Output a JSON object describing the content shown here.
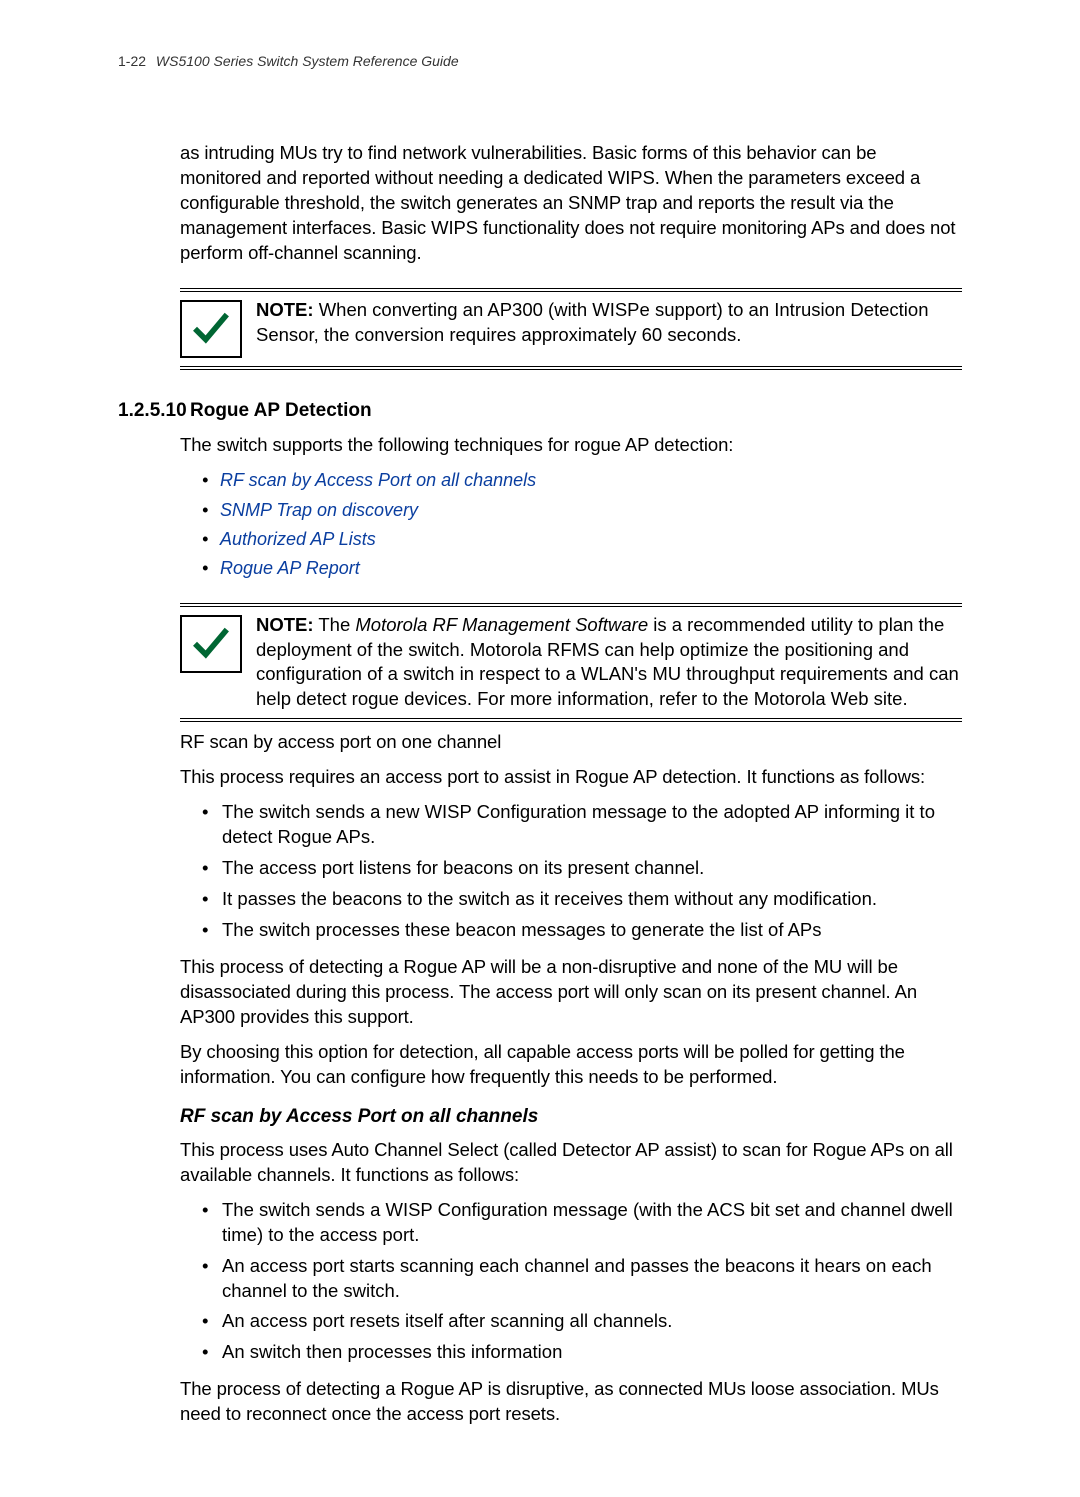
{
  "header": {
    "page_num": "1-22",
    "doc_title": "WS5100 Series Switch System Reference Guide"
  },
  "intro_para": "as intruding MUs try to find network vulnerabilities. Basic forms of this behavior can be monitored and reported without needing a dedicated WIPS. When the parameters exceed a configurable threshold, the switch generates an SNMP trap and reports the result via the management interfaces. Basic WIPS functionality does not require monitoring APs and does not perform off-channel scanning.",
  "note1": {
    "label": "NOTE:",
    "text": " When converting an AP300 (with WISPe support) to an Intrusion Detection Sensor, the conversion requires approximately 60 seconds."
  },
  "section": {
    "num": "1.2.5.10",
    "title": "Rogue AP Detection",
    "intro": "The switch supports the following techniques for rogue AP detection:",
    "links": [
      "RF scan by Access Port on all channels",
      "SNMP Trap on discovery",
      "Authorized AP Lists",
      "Rogue AP Report"
    ]
  },
  "note2": {
    "label": "NOTE:",
    "prefix": " The ",
    "em": "Motorola RF Management Software",
    "text": " is a recommended utility to plan the deployment of the switch. Motorola RFMS can help optimize the positioning and configuration of a switch in respect to a WLAN's MU throughput requirements and can help detect rogue devices. For more information, refer to the Motorola Web site."
  },
  "rfscan_one": {
    "title": "RF scan by access port on one channel",
    "p1": "This process requires an access port to assist in Rogue AP detection. It functions as follows:",
    "bullets": [
      "The switch sends a new WISP Configuration message to the adopted AP informing it to detect Rogue APs.",
      "The access port listens for beacons on its present channel.",
      "It passes the beacons to the switch as it receives them without any modification.",
      "The switch processes these beacon messages to generate the list of APs"
    ],
    "p2": "This process of detecting a Rogue AP will be a non-disruptive and none of the MU will be disassociated during this process. The access port will only scan on its present channel. An AP300 provides this support.",
    "p3": "By choosing this option for detection, all capable access ports will be polled for getting the information. You can configure how frequently this needs to be performed."
  },
  "rfscan_all": {
    "title": "RF scan by Access Port on all channels",
    "p1": "This process uses Auto Channel Select (called Detector AP assist) to scan for Rogue APs on all available channels. It functions as follows:",
    "bullets": [
      "The switch sends a WISP Configuration message (with the ACS bit set and channel dwell time) to the access port.",
      "An access port starts scanning each channel and passes the beacons it hears on each channel to the switch.",
      "An access port resets itself after scanning all channels.",
      "An switch then processes this information"
    ],
    "p2": "The process of detecting a Rogue AP is disruptive, as connected MUs loose association. MUs need to reconnect once the access port resets."
  }
}
